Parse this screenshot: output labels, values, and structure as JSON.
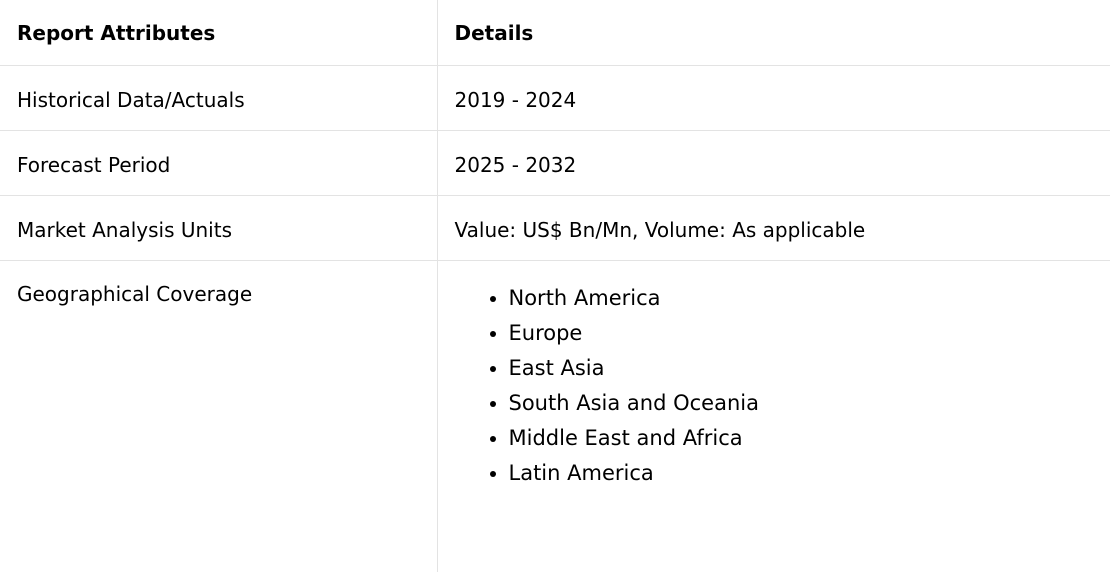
{
  "header": {
    "col1": "Report Attributes",
    "col2": "Details"
  },
  "rows": [
    {
      "attribute": "Historical Data/Actuals",
      "detail": "2019 - 2024"
    },
    {
      "attribute": "Forecast Period",
      "detail": "2025 - 2032"
    },
    {
      "attribute": "Market Analysis Units",
      "detail": "Value: US$ Bn/Mn, Volume: As applicable"
    }
  ],
  "coverage": {
    "attribute": "Geographical Coverage",
    "regions": [
      "North America",
      "Europe",
      "East Asia",
      "South Asia and Oceania",
      "Middle East and Africa",
      "Latin America"
    ]
  },
  "colors": {
    "border": "#e3e3e3",
    "text": "#000000",
    "background": "#ffffff"
  }
}
